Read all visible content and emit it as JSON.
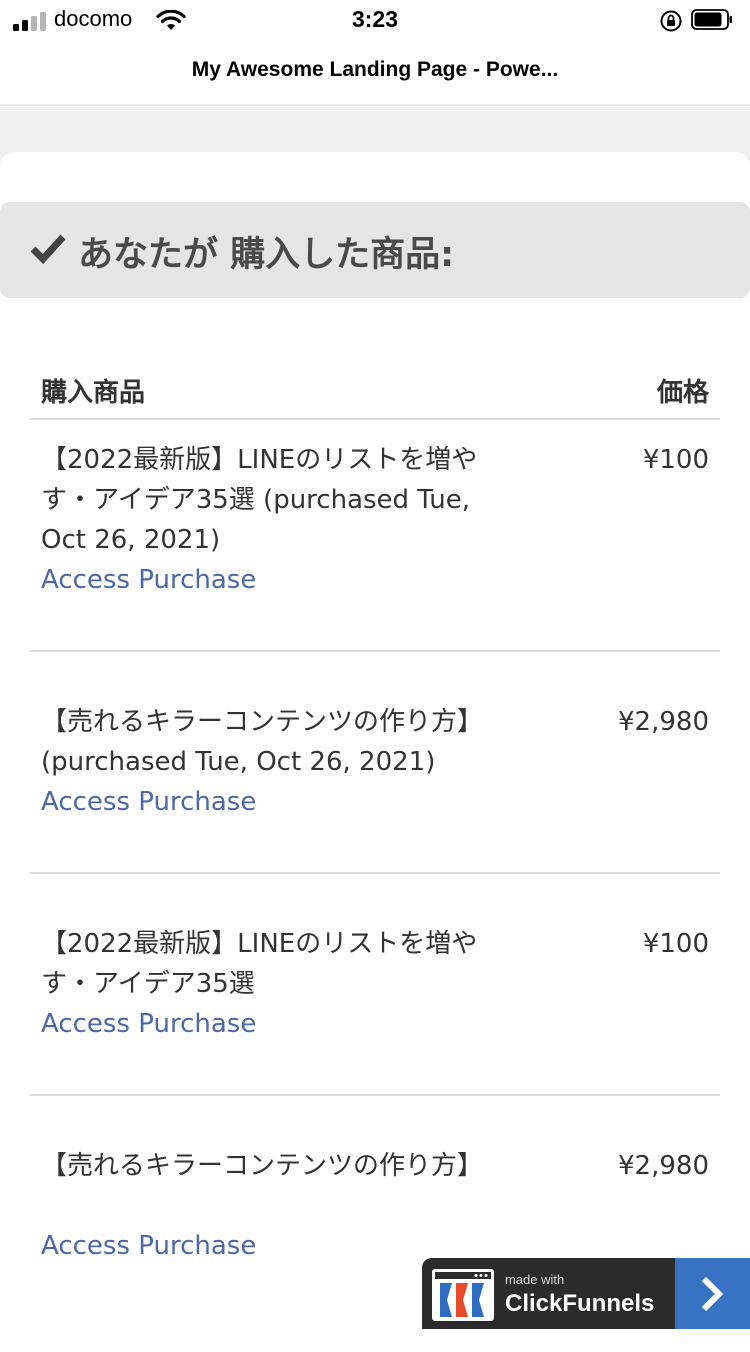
{
  "status_bar": {
    "carrier": "docomo",
    "time": "3:23"
  },
  "browser": {
    "title": "My Awesome Landing Page - Powe..."
  },
  "section": {
    "heading": "あなたが 購入した商品:"
  },
  "table": {
    "headers": {
      "product": "購入商品",
      "price": "価格"
    },
    "rows": [
      {
        "name": "【2022最新版】LINEのリストを増やす・アイデア35選 (purchased Tue, Oct 26, 2021)",
        "price": "¥100",
        "link": "Access Purchase"
      },
      {
        "name": "【売れるキラーコンテンツの作り方】 (purchased Tue, Oct 26, 2021)",
        "price": "¥2,980",
        "link": "Access Purchase"
      },
      {
        "name": "【2022最新版】LINEのリストを増やす・アイデア35選",
        "price": "¥100",
        "link": "Access Purchase"
      },
      {
        "name": "【売れるキラーコンテンツの作り方】",
        "price": "¥2,980",
        "link": "Access Purchase"
      }
    ]
  },
  "badge": {
    "made_with": "made with",
    "brand": "ClickFunnels"
  },
  "colors": {
    "link": "#4a69a6",
    "heading_bg": "#e5e5e5",
    "badge_bg": "#2b2b2b",
    "badge_accent": "#3673c5"
  },
  "icons": {
    "check": "check-icon",
    "chevron": "chevron-right-icon"
  }
}
